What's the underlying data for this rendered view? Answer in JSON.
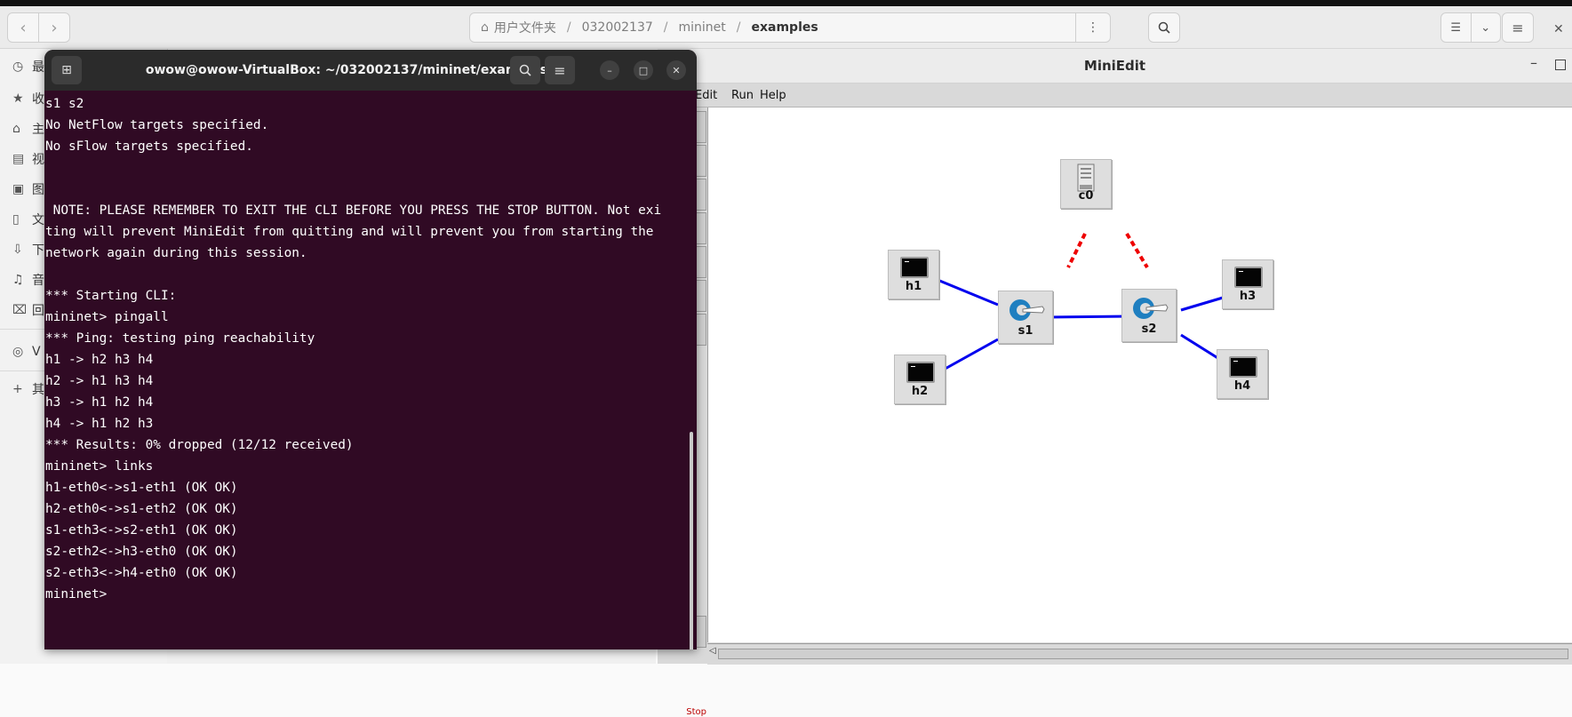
{
  "file_manager": {
    "path": [
      "用户文件夹",
      "032002137",
      "mininet",
      "examples"
    ],
    "sidebar_fragments": [
      "最",
      "收",
      "主",
      "视",
      "图",
      "文",
      "下",
      "音",
      "回",
      "V",
      "其"
    ]
  },
  "miniedit": {
    "title": "MiniEdit",
    "menu": [
      "Edit",
      "Run",
      "Help"
    ],
    "stop_label": "Stop",
    "nodes": {
      "c0": "c0",
      "h1": "h1",
      "h2": "h2",
      "h3": "h3",
      "h4": "h4",
      "s1": "s1",
      "s2": "s2"
    },
    "colors": {
      "link": "#0000ee",
      "controller_link": "#ee0000"
    }
  },
  "terminal": {
    "title": "owow@owow-VirtualBox: ~/032002137/mininet/examples",
    "lines": [
      "s1 s2",
      "No NetFlow targets specified.",
      "No sFlow targets specified.",
      "",
      "",
      " NOTE: PLEASE REMEMBER TO EXIT THE CLI BEFORE YOU PRESS THE STOP BUTTON. Not exi",
      "ting will prevent MiniEdit from quitting and will prevent you from starting the",
      "network again during this session.",
      "",
      "*** Starting CLI:",
      "mininet> pingall",
      "*** Ping: testing ping reachability",
      "h1 -> h2 h3 h4",
      "h2 -> h1 h3 h4",
      "h3 -> h1 h2 h4",
      "h4 -> h1 h2 h3",
      "*** Results: 0% dropped (12/12 received)",
      "mininet> links",
      "h1-eth0<->s1-eth1 (OK OK)",
      "h2-eth0<->s1-eth2 (OK OK)",
      "s1-eth3<->s2-eth1 (OK OK)",
      "s2-eth2<->h3-eth0 (OK OK)",
      "s2-eth3<->h4-eth0 (OK OK)",
      "mininet>"
    ]
  }
}
